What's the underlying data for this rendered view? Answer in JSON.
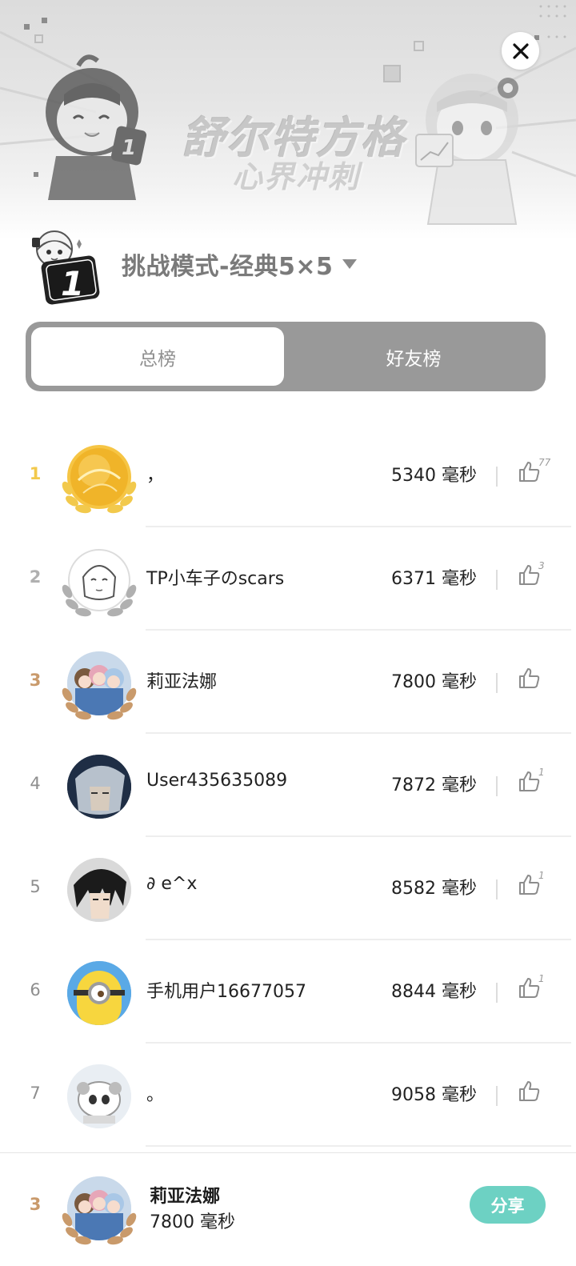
{
  "banner": {
    "title": "舒尔特方格",
    "subtitle": "心界冲刺"
  },
  "header": {
    "mode_title": "挑战模式-经典5×5",
    "logo_number": "1"
  },
  "tabs": [
    {
      "label": "总榜",
      "active": true
    },
    {
      "label": "好友榜",
      "active": false
    }
  ],
  "leaderboard": [
    {
      "rank": "1",
      "name": "，",
      "time": "5340 毫秒",
      "likes": "77",
      "avatar": "gold-orb"
    },
    {
      "rank": "2",
      "name": "TP小车子のscars",
      "time": "6371 毫秒",
      "likes": "3",
      "avatar": "sketch-girl"
    },
    {
      "rank": "3",
      "name": "莉亚法娜",
      "time": "7800 毫秒",
      "likes": "",
      "avatar": "anime-group"
    },
    {
      "rank": "4",
      "name": "User435635089",
      "time": "7872 毫秒",
      "likes": "1",
      "avatar": "silver-hair"
    },
    {
      "rank": "5",
      "name": "∂ e^x",
      "time": "8582 毫秒",
      "likes": "1",
      "avatar": "dark-hair"
    },
    {
      "rank": "6",
      "name": "手机用户16677057",
      "time": "8844 毫秒",
      "likes": "1",
      "avatar": "minion"
    },
    {
      "rank": "7",
      "name": "。",
      "time": "9058 毫秒",
      "likes": "",
      "avatar": "panda-cartoon"
    }
  ],
  "my_rank": {
    "rank": "3",
    "name": "莉亚法娜",
    "time": "7800 毫秒",
    "share_label": "分享"
  },
  "colors": {
    "tab_bg": "#999999",
    "share": "#6dd1c3",
    "rank_gold": "#f2c94c",
    "rank_silver": "#b0b0b0",
    "rank_bronze": "#c99a6b"
  },
  "icons": {
    "close": "close-icon",
    "caret": "caret-down-icon",
    "like": "thumbs-up-icon"
  }
}
